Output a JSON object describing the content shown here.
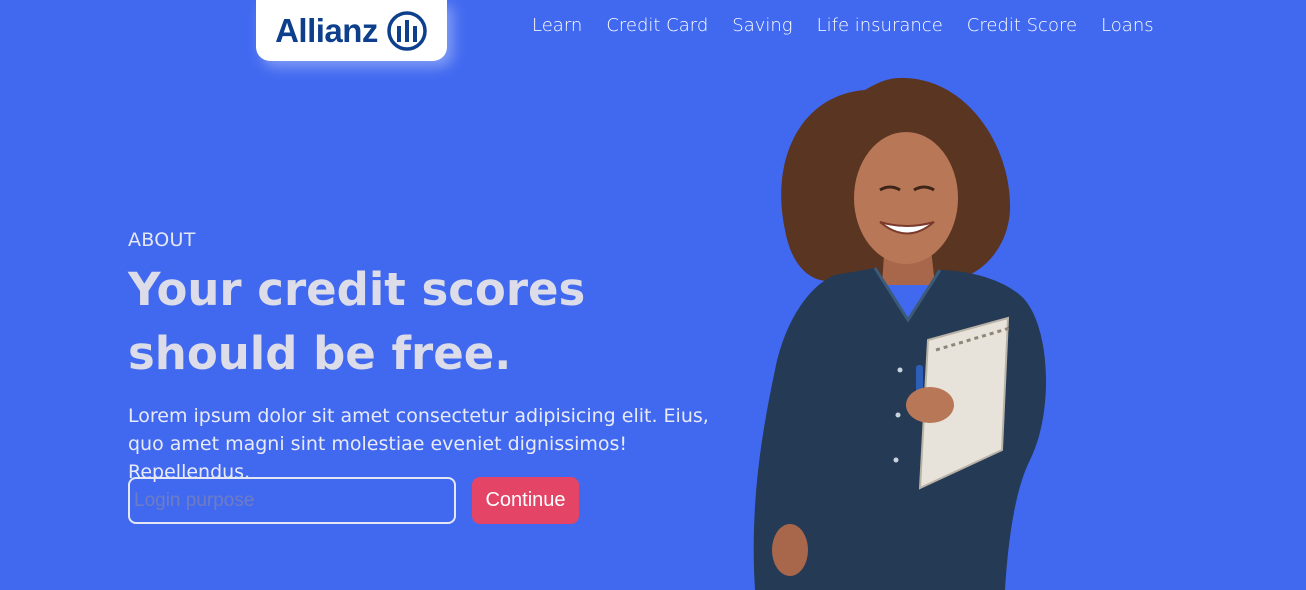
{
  "brand": {
    "name": "Allianz",
    "logo_icon": "allianz-emblem-icon",
    "logo_color": "#0d3f8c"
  },
  "nav": {
    "items": [
      {
        "label": "Learn"
      },
      {
        "label": "Credit Card"
      },
      {
        "label": "Saving"
      },
      {
        "label": "Life insurance"
      },
      {
        "label": "Credit Score"
      },
      {
        "label": "Loans"
      }
    ]
  },
  "hero": {
    "eyebrow": "ABOUT",
    "headline": "Your credit scores should be free.",
    "body": "Lorem ipsum dolor sit amet consectetur adipisicing elit. Eius, quo amet magni sint molestiae eveniet dignissimos! Repellendus.",
    "input_placeholder": "Login purpose",
    "input_value": "",
    "cta_label": "Continue",
    "image": "woman-holding-notebook-photo"
  },
  "colors": {
    "background": "#4169f0",
    "cta": "#e44466",
    "text": "#ffffff"
  }
}
